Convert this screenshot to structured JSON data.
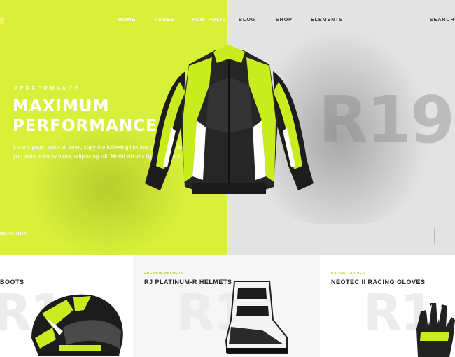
{
  "nav": {
    "items": [
      "HOME",
      "PAGES",
      "PORTFOLIO",
      "BLOG",
      "SHOP",
      "ELEMENTS"
    ],
    "search": "SEARCH"
  },
  "hero": {
    "overline": "PERFORMANCE",
    "title_line1": "MAXIMUM",
    "title_line2": "PERFORMANCE",
    "body": "Lorem ipsum dolor sit amet, copy the following link into you'll use this resource on. If you want to know more, adipiscing elit. Morbi lobortis ligula euismod se.",
    "previous": "PREVIOUS",
    "watermark": "R19",
    "colors": {
      "accent": "#d8f03a",
      "right_bg": "#e3e3e3"
    }
  },
  "products": [
    {
      "category": "",
      "title": "BOOTS",
      "watermark": "R1"
    },
    {
      "category": "PREMIUM HELMETS",
      "title": "RJ PLATINUM-R HELMETS",
      "watermark": "R1"
    },
    {
      "category": "RACING GLOVES",
      "title": "NEOTEC II RACING GLOVES",
      "watermark": "R1"
    }
  ]
}
